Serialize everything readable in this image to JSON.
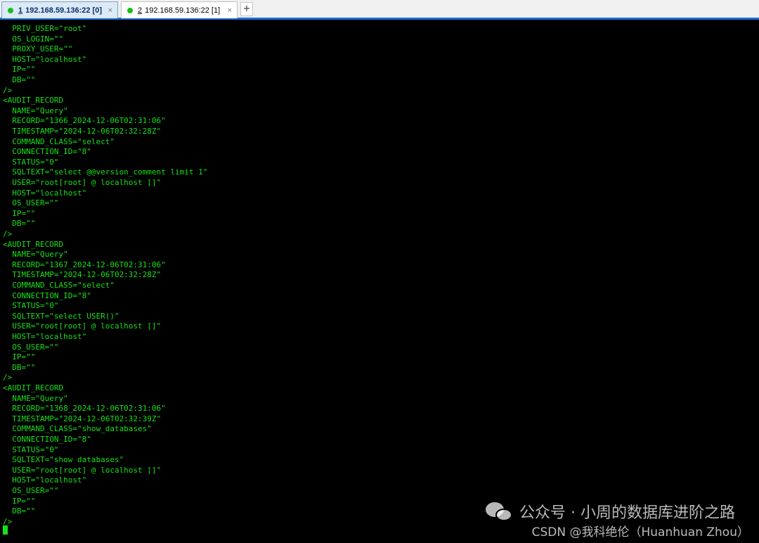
{
  "tabs": [
    {
      "number": "1",
      "title": "192.168.59.136:22 [0]",
      "close": "×",
      "active": true
    },
    {
      "number": "2",
      "title": "192.168.59.136:22 [1]",
      "close": "×",
      "active": false
    }
  ],
  "add_tab": "+",
  "terminal": {
    "lines": [
      "  PRIV_USER=\"root\"",
      "  OS_LOGIN=\"\"",
      "  PROXY_USER=\"\"",
      "  HOST=\"localhost\"",
      "  IP=\"\"",
      "  DB=\"\"",
      "/>",
      "<AUDIT_RECORD",
      "  NAME=\"Query\"",
      "  RECORD=\"1366_2024-12-06T02:31:06\"",
      "  TIMESTAMP=\"2024-12-06T02:32:28Z\"",
      "  COMMAND_CLASS=\"select\"",
      "  CONNECTION_ID=\"8\"",
      "  STATUS=\"0\"",
      "  SQLTEXT=\"select @@version_comment limit 1\"",
      "  USER=\"root[root] @ localhost []\"",
      "  HOST=\"localhost\"",
      "  OS_USER=\"\"",
      "  IP=\"\"",
      "  DB=\"\"",
      "/>",
      "<AUDIT_RECORD",
      "  NAME=\"Query\"",
      "  RECORD=\"1367_2024-12-06T02:31:06\"",
      "  TIMESTAMP=\"2024-12-06T02:32:28Z\"",
      "  COMMAND_CLASS=\"select\"",
      "  CONNECTION_ID=\"8\"",
      "  STATUS=\"0\"",
      "  SQLTEXT=\"select USER()\"",
      "  USER=\"root[root] @ localhost []\"",
      "  HOST=\"localhost\"",
      "  OS_USER=\"\"",
      "  IP=\"\"",
      "  DB=\"\"",
      "/>",
      "<AUDIT_RECORD",
      "  NAME=\"Query\"",
      "  RECORD=\"1368_2024-12-06T02:31:06\"",
      "  TIMESTAMP=\"2024-12-06T02:32:39Z\"",
      "  COMMAND_CLASS=\"show_databases\"",
      "  CONNECTION_ID=\"8\"",
      "  STATUS=\"0\"",
      "  SQLTEXT=\"show databases\"",
      "  USER=\"root[root] @ localhost []\"",
      "  HOST=\"localhost\"",
      "  OS_USER=\"\"",
      "  IP=\"\"",
      "  DB=\"\"",
      "/>"
    ]
  },
  "watermark": {
    "icon": "wechat-icon",
    "line1": "公众号 · 小周的数据库进阶之路",
    "line2": "CSDN @我科绝伦（Huanhuan Zhou）"
  },
  "colors": {
    "terminal_text": "#16e016",
    "terminal_bg": "#000000",
    "tab_accent": "#1e6fd0",
    "status_dot": "#18c018"
  }
}
